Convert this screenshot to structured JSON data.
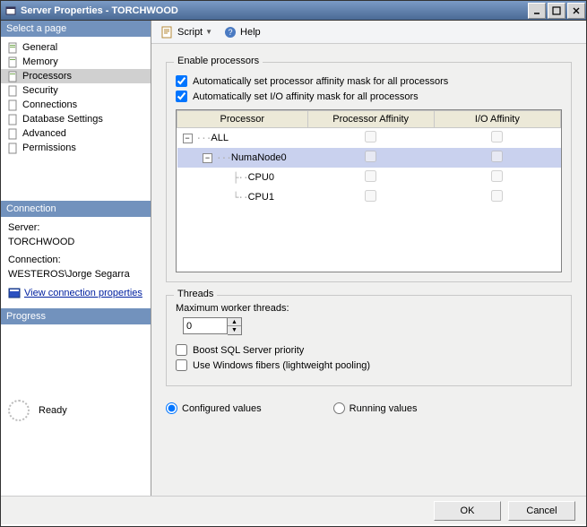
{
  "window": {
    "title": "Server Properties - TORCHWOOD"
  },
  "sidebar": {
    "select_page": "Select a page",
    "items": [
      {
        "label": "General"
      },
      {
        "label": "Memory"
      },
      {
        "label": "Processors"
      },
      {
        "label": "Security"
      },
      {
        "label": "Connections"
      },
      {
        "label": "Database Settings"
      },
      {
        "label": "Advanced"
      },
      {
        "label": "Permissions"
      }
    ],
    "connection_head": "Connection",
    "server_label": "Server:",
    "server_value": "TORCHWOOD",
    "connection_label": "Connection:",
    "connection_value": "WESTEROS\\Jorge Segarra",
    "view_conn_props": "View connection properties",
    "progress_head": "Progress",
    "progress_text": "Ready"
  },
  "toolbar": {
    "script": "Script",
    "help": "Help"
  },
  "processors": {
    "group_title": "Enable processors",
    "auto_cpu": "Automatically set processor affinity mask for all processors",
    "auto_io": "Automatically set I/O affinity mask for all processors",
    "col_processor": "Processor",
    "col_paff": "Processor Affinity",
    "col_ioaff": "I/O Affinity",
    "rows": [
      {
        "label": "ALL"
      },
      {
        "label": "NumaNode0"
      },
      {
        "label": "CPU0"
      },
      {
        "label": "CPU1"
      }
    ]
  },
  "threads": {
    "group_title": "Threads",
    "max_worker": "Maximum worker threads:",
    "max_worker_value": "0",
    "boost": "Boost SQL Server priority",
    "fibers": "Use Windows fibers (lightweight pooling)"
  },
  "radios": {
    "configured": "Configured  values",
    "running": "Running values"
  },
  "buttons": {
    "ok": "OK",
    "cancel": "Cancel"
  }
}
